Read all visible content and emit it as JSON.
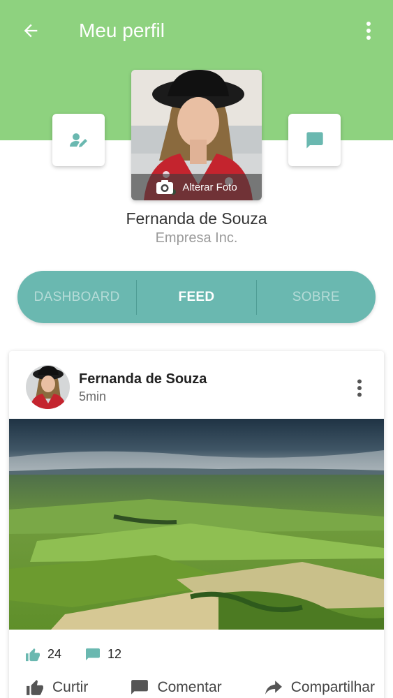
{
  "header": {
    "title": "Meu perfil",
    "background_color": "#8ed27f",
    "back_icon": "arrow-left-icon",
    "menu_icon": "more-vertical-icon"
  },
  "profile": {
    "photo_action_label": "Alterar Foto",
    "name": "Fernanda de Souza",
    "company": "Empresa Inc.",
    "edit_icon": "edit-user-icon",
    "message_icon": "message-icon"
  },
  "tabs": {
    "items": [
      {
        "label": "DASHBOARD",
        "active": false
      },
      {
        "label": "FEED",
        "active": true
      },
      {
        "label": "SOBRE",
        "active": false
      }
    ],
    "color": "#6ab8b0"
  },
  "post": {
    "author": "Fernanda de Souza",
    "time": "5min",
    "likes": "24",
    "comments": "12",
    "actions": {
      "like": "Curtir",
      "comment": "Comentar",
      "share": "Compartilhar"
    },
    "accent_color": "#6ab8b0"
  }
}
